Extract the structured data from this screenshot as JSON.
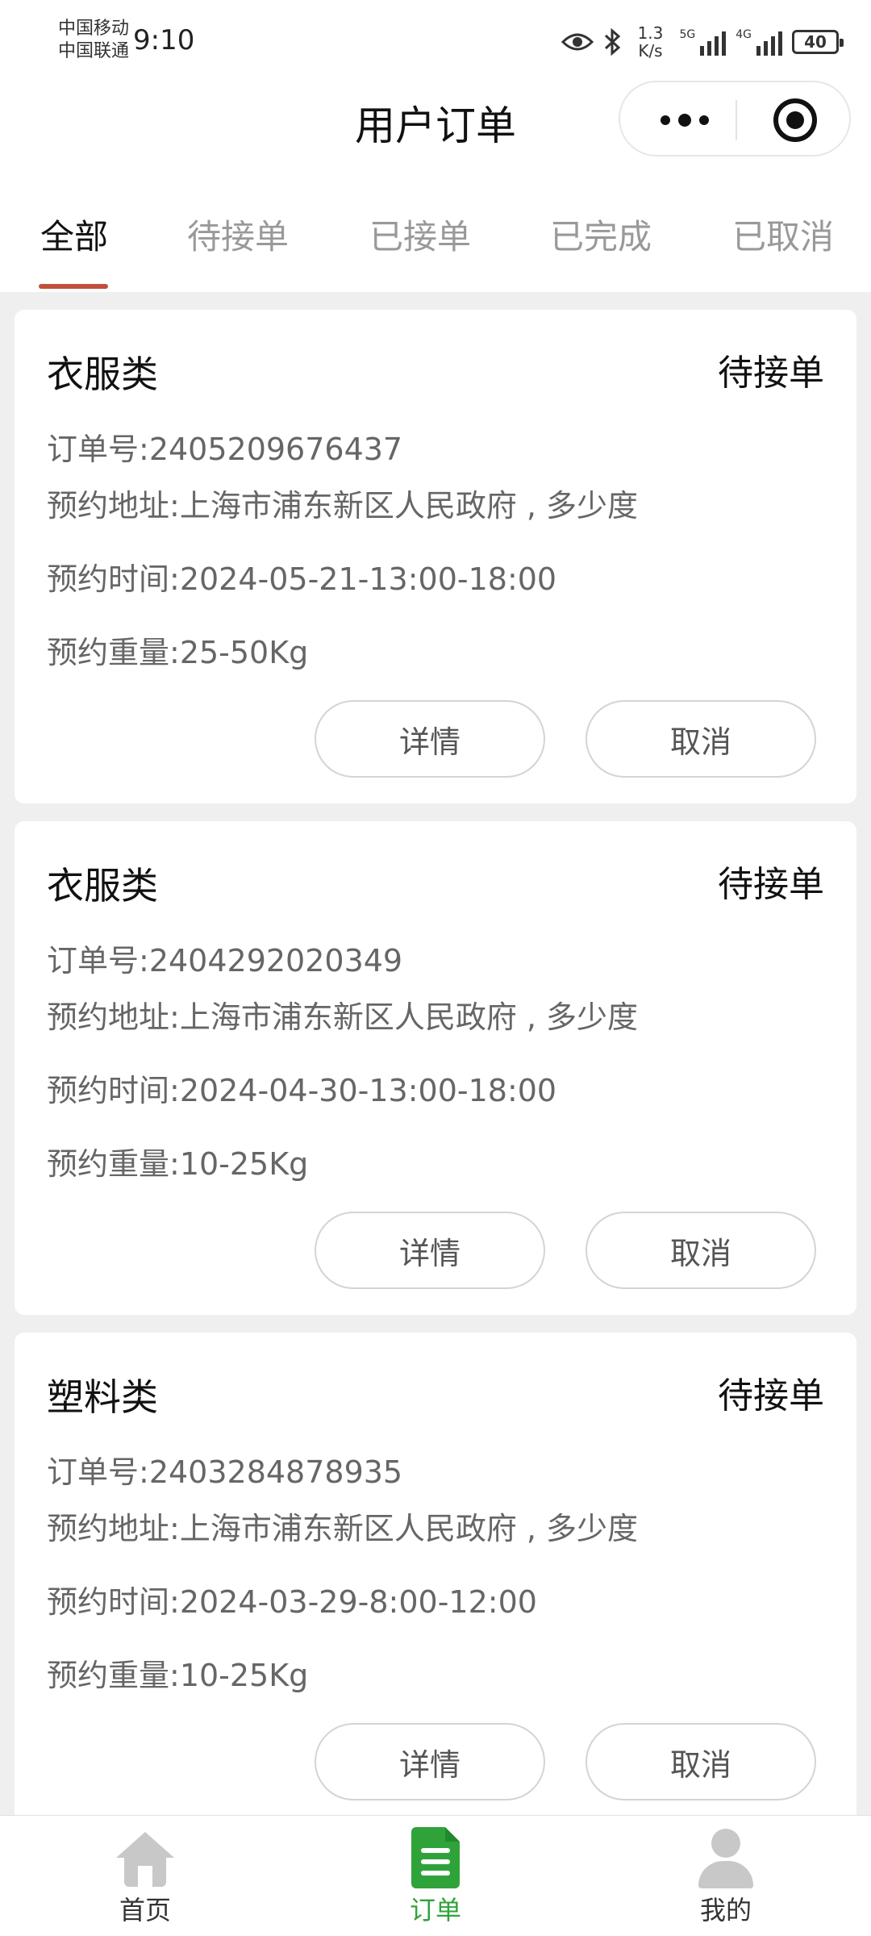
{
  "status_bar": {
    "carrier_1": "中国移动",
    "carrier_2": "中国联通",
    "time": "9:10",
    "net_speed_value": "1.3",
    "net_speed_unit": "K/s",
    "sig1_label": "5G",
    "sig2_label": "4G",
    "battery": "40"
  },
  "header": {
    "title": "用户订单"
  },
  "tabs": [
    {
      "label": "全部"
    },
    {
      "label": "待接单"
    },
    {
      "label": "已接单"
    },
    {
      "label": "已完成"
    },
    {
      "label": "已取消"
    }
  ],
  "colors": {
    "accent_indicator": "#c0503c",
    "active_nav": "#2fa33a",
    "list_bg": "#efefef"
  },
  "orders": [
    {
      "category": "衣服类",
      "status": "待接单",
      "order_no_label": "订单号:",
      "order_no": "2405209676437",
      "address_label": "预约地址:",
      "address": "上海市浦东新区人民政府 , 多少度",
      "time_label": "预约时间:",
      "time": "2024-05-21-13:00-18:00",
      "weight_label": "预约重量:",
      "weight": "25-50Kg",
      "detail_label": "详情",
      "cancel_label": "取消"
    },
    {
      "category": "衣服类",
      "status": "待接单",
      "order_no_label": "订单号:",
      "order_no": "2404292020349",
      "address_label": "预约地址:",
      "address": "上海市浦东新区人民政府 , 多少度",
      "time_label": "预约时间:",
      "time": "2024-04-30-13:00-18:00",
      "weight_label": "预约重量:",
      "weight": "10-25Kg",
      "detail_label": "详情",
      "cancel_label": "取消"
    },
    {
      "category": "塑料类",
      "status": "待接单",
      "order_no_label": "订单号:",
      "order_no": "2403284878935",
      "address_label": "预约地址:",
      "address": "上海市浦东新区人民政府 , 多少度",
      "time_label": "预约时间:",
      "time": "2024-03-29-8:00-12:00",
      "weight_label": "预约重量:",
      "weight": "10-25Kg",
      "detail_label": "详情",
      "cancel_label": "取消"
    }
  ],
  "bottom_nav": [
    {
      "label": "首页",
      "icon": "home-icon"
    },
    {
      "label": "订单",
      "icon": "order-list-icon"
    },
    {
      "label": "我的",
      "icon": "person-icon"
    }
  ]
}
